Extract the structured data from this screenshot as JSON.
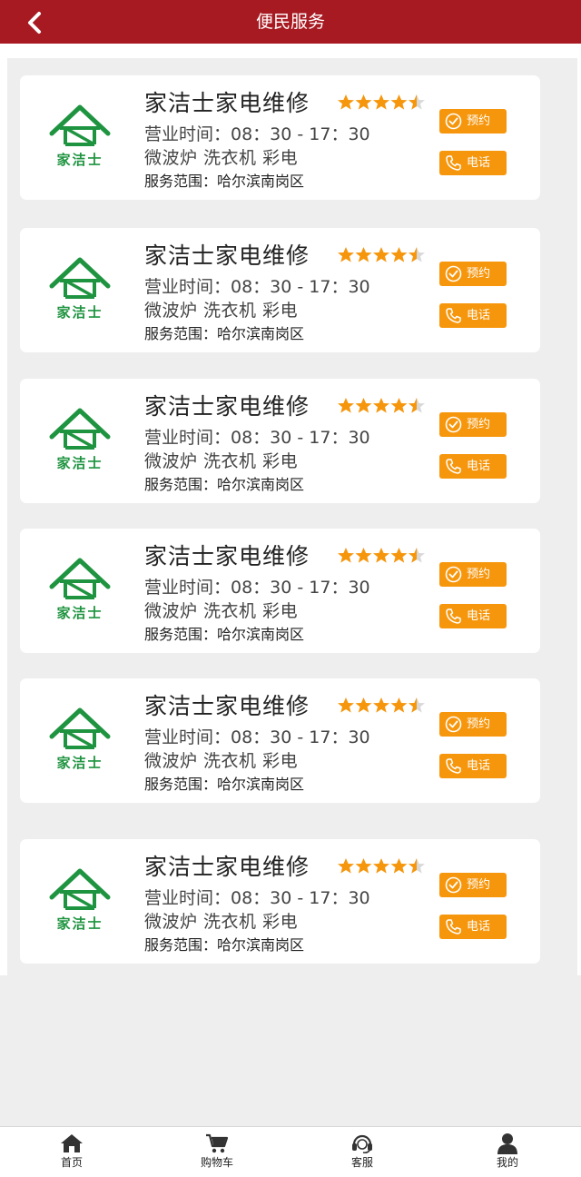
{
  "header": {
    "title": "便民服务",
    "back_icon": "chevron-left-icon",
    "background": "#a81a22"
  },
  "accent_color": "#f6960c",
  "listings": [
    {
      "logo_text": "家洁士",
      "name": "家洁士家电维修",
      "rating": 4.5,
      "hours": "营业时间：08：30 - 17：30",
      "categories": "微波炉 洗衣机 彩电",
      "area": "服务范围：哈尔滨南岗区",
      "book_label": "预约",
      "call_label": "电话"
    },
    {
      "logo_text": "家洁士",
      "name": "家洁士家电维修",
      "rating": 4.5,
      "hours": "营业时间：08：30 - 17：30",
      "categories": "微波炉 洗衣机 彩电",
      "area": "服务范围：哈尔滨南岗区",
      "book_label": "预约",
      "call_label": "电话"
    },
    {
      "logo_text": "家洁士",
      "name": "家洁士家电维修",
      "rating": 4.5,
      "hours": "营业时间：08：30 - 17：30",
      "categories": "微波炉 洗衣机 彩电",
      "area": "服务范围：哈尔滨南岗区",
      "book_label": "预约",
      "call_label": "电话"
    },
    {
      "logo_text": "家洁士",
      "name": "家洁士家电维修",
      "rating": 4.5,
      "hours": "营业时间：08：30 - 17：30",
      "categories": "微波炉 洗衣机 彩电",
      "area": "服务范围：哈尔滨南岗区",
      "book_label": "预约",
      "call_label": "电话"
    },
    {
      "logo_text": "家洁士",
      "name": "家洁士家电维修",
      "rating": 4.5,
      "hours": "营业时间：08：30 - 17：30",
      "categories": "微波炉 洗衣机 彩电",
      "area": "服务范围：哈尔滨南岗区",
      "book_label": "预约",
      "call_label": "电话"
    },
    {
      "logo_text": "家洁士",
      "name": "家洁士家电维修",
      "rating": 4.5,
      "hours": "营业时间：08：30 - 17：30",
      "categories": "微波炉 洗衣机 彩电",
      "area": "服务范围：哈尔滨南岗区",
      "book_label": "预约",
      "call_label": "电话"
    }
  ],
  "tabbar": {
    "items": [
      {
        "label": "首页",
        "icon": "home-icon"
      },
      {
        "label": "购物车",
        "icon": "cart-icon"
      },
      {
        "label": "客服",
        "icon": "headset-icon"
      },
      {
        "label": "我的",
        "icon": "user-icon"
      }
    ]
  }
}
